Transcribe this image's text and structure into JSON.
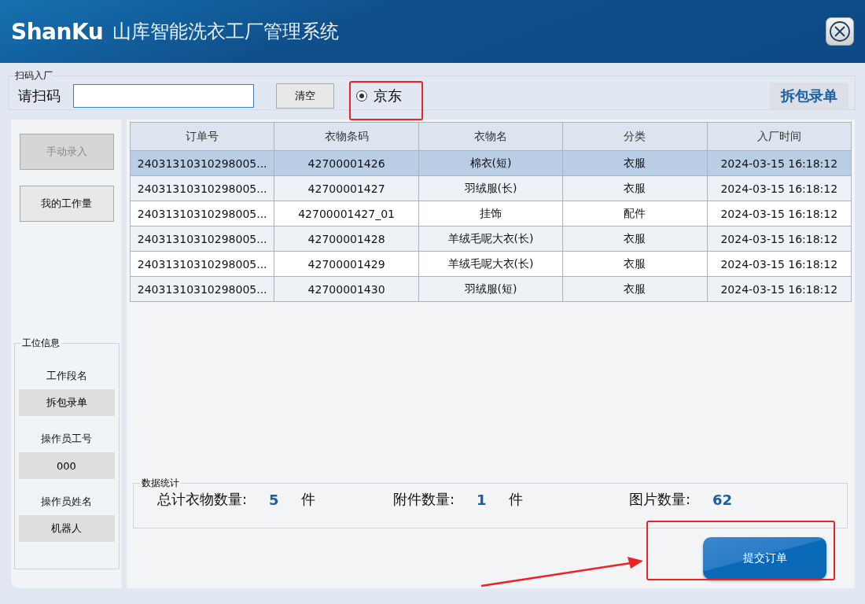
{
  "header": {
    "logo": "ShanKu",
    "title": "山库智能洗衣工厂管理系统"
  },
  "scan": {
    "group_label": "扫码入厂",
    "field_label": "请扫码",
    "clear_button": "清空",
    "radio": {
      "label": "京东",
      "selected": true
    },
    "mode_button": "拆包录单"
  },
  "sidebar": {
    "buttons": [
      {
        "label": "手动录入",
        "disabled": true
      },
      {
        "label": "我的工作量",
        "disabled": false
      }
    ],
    "station": {
      "group_label": "工位信息",
      "fields": [
        {
          "label": "工作段名",
          "value": "拆包录单"
        },
        {
          "label": "操作员工号",
          "value": "000"
        },
        {
          "label": "操作员姓名",
          "value": "机器人"
        }
      ]
    }
  },
  "table": {
    "columns": [
      "订单号",
      "衣物条码",
      "衣物名",
      "分类",
      "入厂时间"
    ],
    "rows": [
      {
        "selected": true,
        "cells": [
          "24031310310298005...",
          "42700001426",
          "棉衣(短)",
          "衣服",
          "2024-03-15 16:18:12"
        ]
      },
      {
        "selected": false,
        "cells": [
          "24031310310298005...",
          "42700001427",
          "羽绒服(长)",
          "衣服",
          "2024-03-15 16:18:12"
        ]
      },
      {
        "selected": false,
        "cells": [
          "24031310310298005...",
          "42700001427_01",
          "挂饰",
          "配件",
          "2024-03-15 16:18:12"
        ]
      },
      {
        "selected": false,
        "cells": [
          "24031310310298005...",
          "42700001428",
          "羊绒毛呢大衣(长)",
          "衣服",
          "2024-03-15 16:18:12"
        ]
      },
      {
        "selected": false,
        "cells": [
          "24031310310298005...",
          "42700001429",
          "羊绒毛呢大衣(长)",
          "衣服",
          "2024-03-15 16:18:12"
        ]
      },
      {
        "selected": false,
        "cells": [
          "24031310310298005...",
          "42700001430",
          "羽绒服(短)",
          "衣服",
          "2024-03-15 16:18:12"
        ]
      }
    ]
  },
  "stats": {
    "group_label": "数据统计",
    "items": [
      {
        "label": "总计衣物数量:",
        "value": "5",
        "unit": "件"
      },
      {
        "label": "附件数量:",
        "value": "1",
        "unit": "件"
      },
      {
        "label": "图片数量:",
        "value": "62"
      }
    ]
  },
  "submit_button": "提交订单"
}
